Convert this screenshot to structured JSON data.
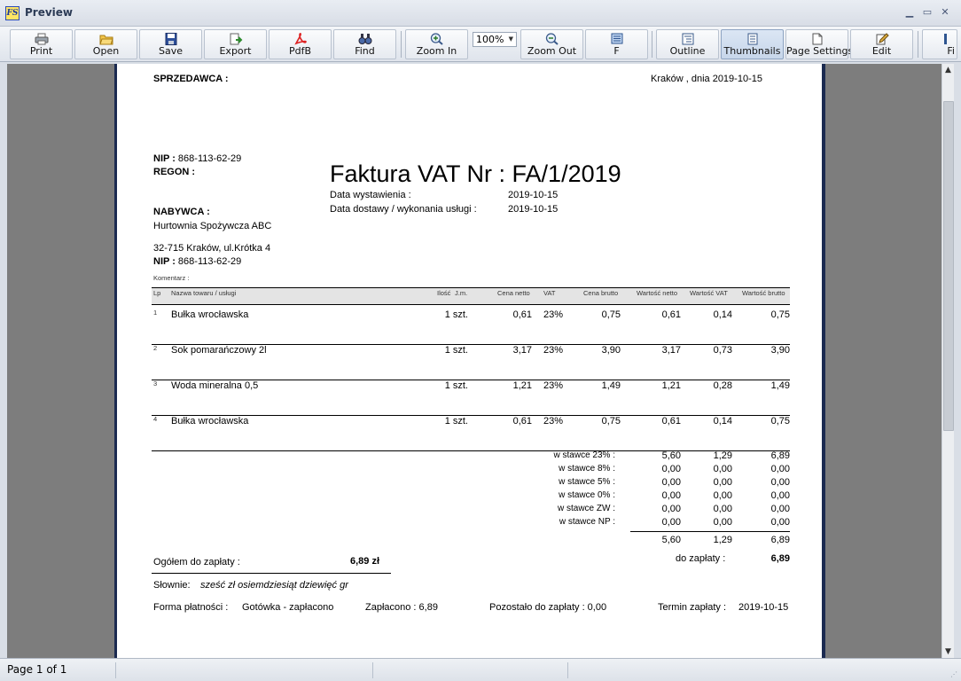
{
  "window": {
    "title": "Preview",
    "icon_text": "FS"
  },
  "toolbar": {
    "buttons": [
      {
        "label": "Print",
        "icon": "printer-icon"
      },
      {
        "label": "Open",
        "icon": "folder-open-icon"
      },
      {
        "label": "Save",
        "icon": "floppy-disk-icon"
      },
      {
        "label": "Export",
        "icon": "export-icon"
      },
      {
        "label": "PdfB",
        "icon": "pdf-icon"
      },
      {
        "label": "Find",
        "icon": "binoculars-icon"
      },
      {
        "label": "Zoom In",
        "icon": "zoom-in-icon"
      },
      {
        "label": "Zoom Out",
        "icon": "zoom-out-icon"
      },
      {
        "label": "F",
        "icon": "fullscreen-icon"
      },
      {
        "label": "Outline",
        "icon": "outline-icon"
      },
      {
        "label": "Thumbnails",
        "icon": "thumbnails-icon"
      },
      {
        "label": "Page Settings",
        "icon": "page-settings-icon"
      },
      {
        "label": "Edit",
        "icon": "edit-icon"
      },
      {
        "label": "Fi",
        "icon": "first-page-icon"
      }
    ],
    "zoom_value": "100%"
  },
  "status": {
    "page_indicator": "Page 1 of 1"
  },
  "invoice": {
    "seller_label": "SPRZEDAWCA :",
    "place_date": "Kraków , dnia   2019-10-15",
    "nip_label": "NIP :",
    "seller_nip": "868-113-62-29",
    "regon_label": "REGON :",
    "title": "Faktura VAT Nr :  FA/1/2019",
    "issue_label": "Data wystawienia :",
    "issue_date": "2019-10-15",
    "delivery_label": "Data dostawy / wykonania usługi :",
    "delivery_date": "2019-10-15",
    "buyer_label": "NABYWCA :",
    "buyer_name": "Hurtownia Spożywcza ABC",
    "buyer_address": "32-715 Kraków, ul.Krótka 4",
    "buyer_nip": "868-113-62-29",
    "comment_label": "Komentarz :",
    "columns": [
      "Lp",
      "Nazwa towaru / usługi",
      "Ilość",
      "J.m.",
      "Cena netto",
      "VAT",
      "Cena brutto",
      "Wartość netto",
      "Wartość VAT",
      "Wartość brutto"
    ],
    "items": [
      {
        "lp": "1",
        "name": "Bułka wrocławska",
        "qty": "1 szt.",
        "net_price": "0,61",
        "vat": "23%",
        "gross_price": "0,75",
        "net_value": "0,61",
        "vat_value": "0,14",
        "gross_value": "0,75"
      },
      {
        "lp": "2",
        "name": "Sok pomarańczowy 2l",
        "qty": "1 szt.",
        "net_price": "3,17",
        "vat": "23%",
        "gross_price": "3,90",
        "net_value": "3,17",
        "vat_value": "0,73",
        "gross_value": "3,90"
      },
      {
        "lp": "3",
        "name": "Woda mineralna 0,5",
        "qty": "1 szt.",
        "net_price": "1,21",
        "vat": "23%",
        "gross_price": "1,49",
        "net_value": "1,21",
        "vat_value": "0,28",
        "gross_value": "1,49"
      },
      {
        "lp": "4",
        "name": "Bułka wrocławska",
        "qty": "1 szt.",
        "net_price": "0,61",
        "vat": "23%",
        "gross_price": "0,75",
        "net_value": "0,61",
        "vat_value": "0,14",
        "gross_value": "0,75"
      }
    ],
    "rates": [
      {
        "label": "w stawce 23% :",
        "net": "5,60",
        "vat": "1,29",
        "gross": "6,89"
      },
      {
        "label": "w stawce 8% :",
        "net": "0,00",
        "vat": "0,00",
        "gross": "0,00"
      },
      {
        "label": "w stawce 5% :",
        "net": "0,00",
        "vat": "0,00",
        "gross": "0,00"
      },
      {
        "label": "w stawce 0% :",
        "net": "0,00",
        "vat": "0,00",
        "gross": "0,00"
      },
      {
        "label": "w stawce ZW :",
        "net": "0,00",
        "vat": "0,00",
        "gross": "0,00"
      },
      {
        "label": "w stawce NP :",
        "net": "0,00",
        "vat": "0,00",
        "gross": "0,00"
      }
    ],
    "totals": {
      "net": "5,60",
      "vat": "1,29",
      "gross": "6,89"
    },
    "total_label": "Ogółem do zapłaty :",
    "total_amount": "6,89 zł",
    "to_pay_label": "do zapłaty :",
    "to_pay_value": "6,89",
    "words_label": "Słownie:",
    "words_value": "sześć zł osiemdziesiąt dziewięć gr",
    "payment_form_label": "Forma płatności :",
    "payment_form_value": "Gotówka - zapłacono",
    "paid": "Zapłacono : 6,89",
    "remaining": "Pozostało do zapłaty : 0,00",
    "due_label": "Termin zapłaty :",
    "due_date": "2019-10-15"
  }
}
